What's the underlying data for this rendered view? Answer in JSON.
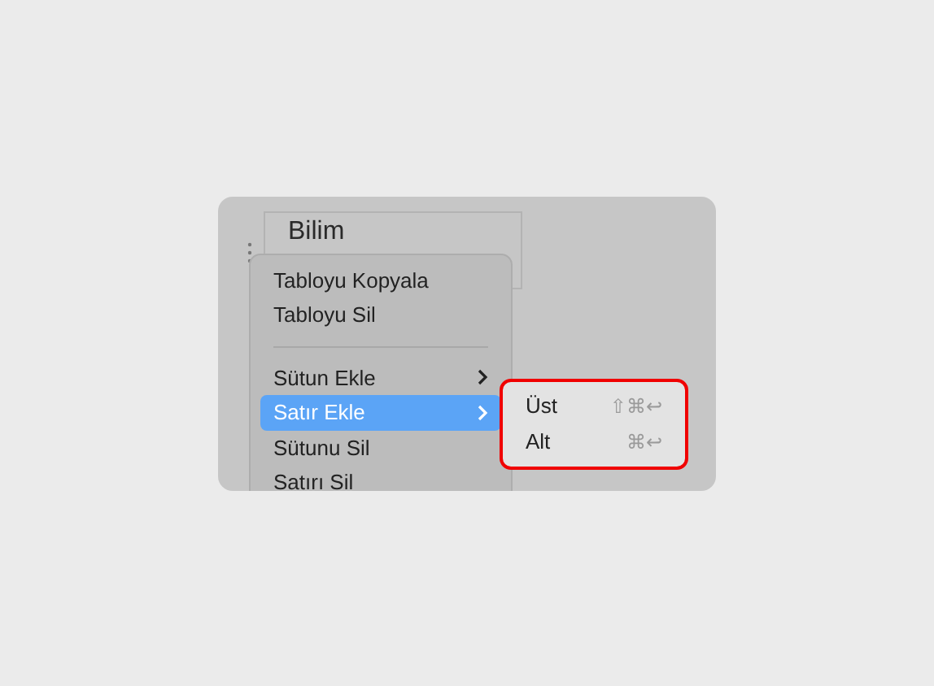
{
  "table": {
    "cell": "Bilim"
  },
  "menu": {
    "items": [
      {
        "kind": "item",
        "label": "Tabloyu Kopyala",
        "submenu": false,
        "selected": false
      },
      {
        "kind": "item",
        "label": "Tabloyu Sil",
        "submenu": false,
        "selected": false
      },
      {
        "kind": "separator"
      },
      {
        "kind": "item",
        "label": "Sütun Ekle",
        "submenu": true,
        "selected": false
      },
      {
        "kind": "item",
        "label": "Satır Ekle",
        "submenu": true,
        "selected": true
      },
      {
        "kind": "item",
        "label": "Sütunu Sil",
        "submenu": false,
        "selected": false
      },
      {
        "kind": "item",
        "label": "Satırı Sil",
        "submenu": false,
        "selected": false
      }
    ]
  },
  "submenu": {
    "highlighted": true,
    "items": [
      {
        "label": "Üst",
        "shortcut": "⇧⌘↩"
      },
      {
        "label": "Alt",
        "shortcut": "⌘↩"
      }
    ]
  }
}
